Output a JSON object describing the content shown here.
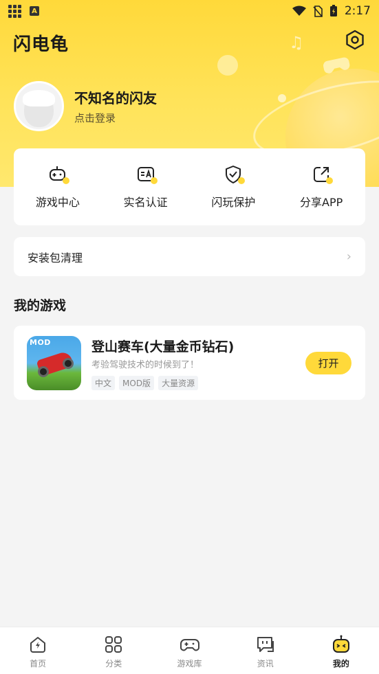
{
  "status_bar": {
    "time": "2:17"
  },
  "header": {
    "app_name": "闪电龟"
  },
  "profile": {
    "username": "不知名的闪友",
    "login_label": "点击登录"
  },
  "quick_actions": [
    {
      "label": "游戏中心",
      "icon": "gamepad-icon"
    },
    {
      "label": "实名认证",
      "icon": "id-card-icon"
    },
    {
      "label": "闪玩保护",
      "icon": "shield-check-icon"
    },
    {
      "label": "分享APP",
      "icon": "share-icon"
    }
  ],
  "cleanup": {
    "label": "安装包清理",
    "chevron": "›"
  },
  "my_games": {
    "title": "我的游戏",
    "games": [
      {
        "icon_tag": "MOD",
        "title": "登山赛车(大量金币钻石)",
        "description": "考验驾驶技术的时候到了！",
        "tags": [
          "中文",
          "MOD版",
          "大量资源"
        ],
        "action": "打开"
      }
    ]
  },
  "bottom_nav": [
    {
      "label": "首页",
      "icon": "home-bolt-icon",
      "active": false
    },
    {
      "label": "分类",
      "icon": "category-grid-icon",
      "active": false
    },
    {
      "label": "游戏库",
      "icon": "gamepad-icon",
      "active": false
    },
    {
      "label": "资讯",
      "icon": "news-chat-icon",
      "active": false
    },
    {
      "label": "我的",
      "icon": "robot-profile-icon",
      "active": true
    }
  ],
  "colors": {
    "accent": "#ffd93a",
    "background": "#f4f4f4"
  }
}
